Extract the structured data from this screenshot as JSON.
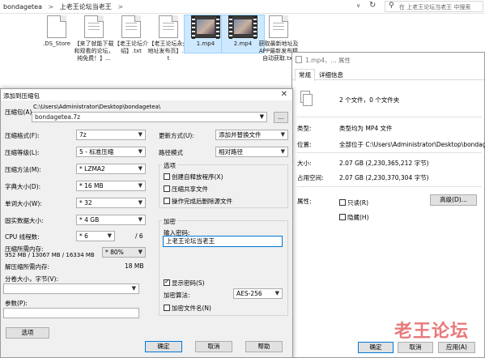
{
  "explorer": {
    "breadcrumb": [
      "bondagetea",
      ">",
      "上老王论坛当老王",
      ">"
    ],
    "search_placeholder": "在 上老王论坛当老王 中搜索",
    "files": [
      {
        "name": ".DS_Store",
        "type": "doc"
      },
      {
        "name": "【来了就能下载和观看的论坛，纯免费！】...",
        "type": "doc"
      },
      {
        "name": "【老王论坛介绍】.txt",
        "type": "doc"
      },
      {
        "name": "【老王论坛永久地址发布页】.txt",
        "type": "doc"
      },
      {
        "name": "1.mp4",
        "type": "video"
      },
      {
        "name": "2.mp4",
        "type": "video"
      },
      {
        "name": "获取最新地址及APP最新发布精自动获取.txt",
        "type": "doc"
      }
    ]
  },
  "archive_dialog": {
    "title": "添加到压缩包",
    "archive_label": "压缩包(A)",
    "archive_dir": "C:\\Users\\Administrator\\Desktop\\bondagetea\\",
    "archive_file": "bondagetea.7z",
    "browse_button": "...",
    "format_label": "压缩格式(F):",
    "format_value": "7z",
    "level_label": "压缩等级(L):",
    "level_value": "5 - 标准压缩",
    "method_label": "压缩方法(M):",
    "method_value": "* LZMA2",
    "dict_label": "字典大小(D):",
    "dict_value": "* 16 MB",
    "word_label": "单词大小(W):",
    "word_value": "* 32",
    "solid_label": "固实数据大小:",
    "solid_value": "* 4 GB",
    "threads_label": "CPU 线程数:",
    "threads_value": "* 6",
    "threads_total": "/ 6",
    "mem_label": "压缩所需内存:",
    "mem_value": "952 MB / 13067 MB / 16334 MB",
    "mem_pct": "* 80%",
    "decomp_label": "解压缩所需内存:",
    "decomp_value": "18 MB",
    "split_label": "分卷大小，字节(V):",
    "params_label": "参数(P):",
    "options_button": "选项",
    "update_label": "更新方式(U):",
    "update_value": "添加并替换文件",
    "path_label": "路径模式",
    "path_value": "相对路径",
    "options_group": "选项",
    "opt_sfx": "创建自释放程序(X)",
    "opt_shared": "压缩共享文件",
    "opt_delete": "操作完成后删除源文件",
    "encrypt_group": "加密",
    "pwd_label": "输入密码:",
    "pwd_value": "上老王论坛当老王",
    "show_pwd": "显示密码(S)",
    "enc_method_label": "加密算法:",
    "enc_method_value": "AES-256",
    "enc_names": "加密文件名(N)",
    "ok": "确定",
    "cancel": "取消",
    "help": "帮助"
  },
  "properties_dialog": {
    "title": "1.mp4，... 属性",
    "tab_general": "常规",
    "tab_details": "详细信息",
    "count": "2 个文件，0 个文件夹",
    "type_label": "类型:",
    "type_value": "类型均为 MP4 文件",
    "location_label": "位置:",
    "location_value": "全部位于 C:\\Users\\Administrator\\Desktop\\bondag",
    "size_label": "大小:",
    "size_value": "2.07 GB (2,230,365,212 字节)",
    "disk_label": "占用空间:",
    "disk_value": "2.07 GB (2,230,370,304 字节)",
    "attr_label": "属性:",
    "readonly": "只读(R)",
    "hidden": "隐藏(H)",
    "advanced": "高级(D)...",
    "ok": "确定",
    "cancel": "取消",
    "apply": "应用(A)"
  },
  "watermark": "老王论坛"
}
